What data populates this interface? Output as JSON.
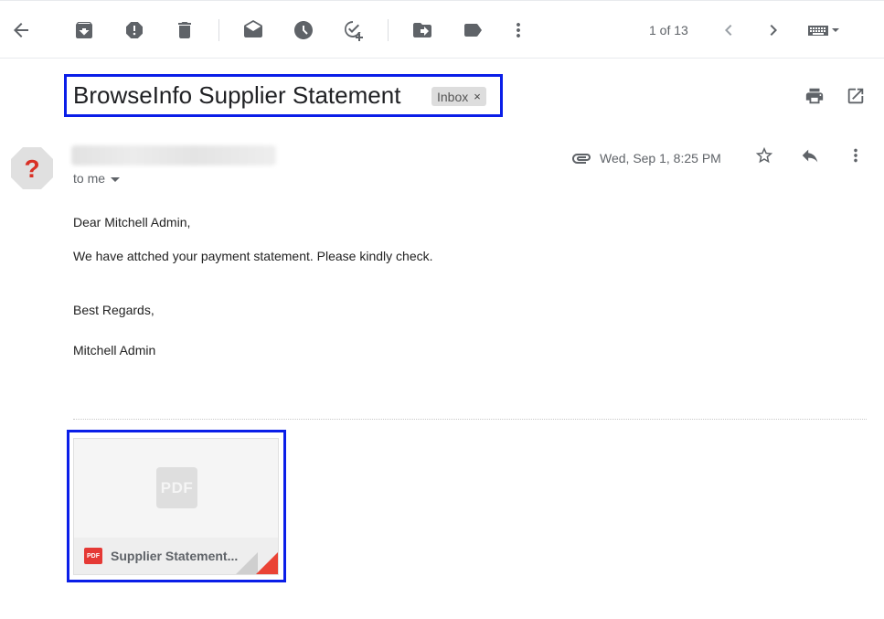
{
  "toolbar": {
    "icons": [
      "back-arrow-icon",
      "archive-icon",
      "report-spam-icon",
      "delete-icon",
      "mark-unread-icon",
      "snooze-icon",
      "add-to-tasks-icon",
      "move-to-icon",
      "labels-icon",
      "more-vert-icon"
    ],
    "pager_text": "1 of 13",
    "input_tools": "keyboard-icon"
  },
  "email": {
    "subject": "BrowseInfo Supplier Statement",
    "label": "Inbox",
    "label_remove": "×",
    "recipient": "to me",
    "date": "Wed, Sep 1, 8:25 PM",
    "body": {
      "greeting": "Dear Mitchell Admin,",
      "line1": "We have attched your payment statement. Please kindly check.",
      "closing": "Best Regards,",
      "signature": "Mitchell Admin"
    }
  },
  "attachment": {
    "thumb_label": "PDF",
    "type_badge": "PDF",
    "name": "Supplier Statement..."
  },
  "colors": {
    "highlight_box": "#0a1ee8",
    "pdf_red": "#ea4335",
    "avatar_bg": "#e0e0e0",
    "avatar_mark": "#d93025"
  }
}
